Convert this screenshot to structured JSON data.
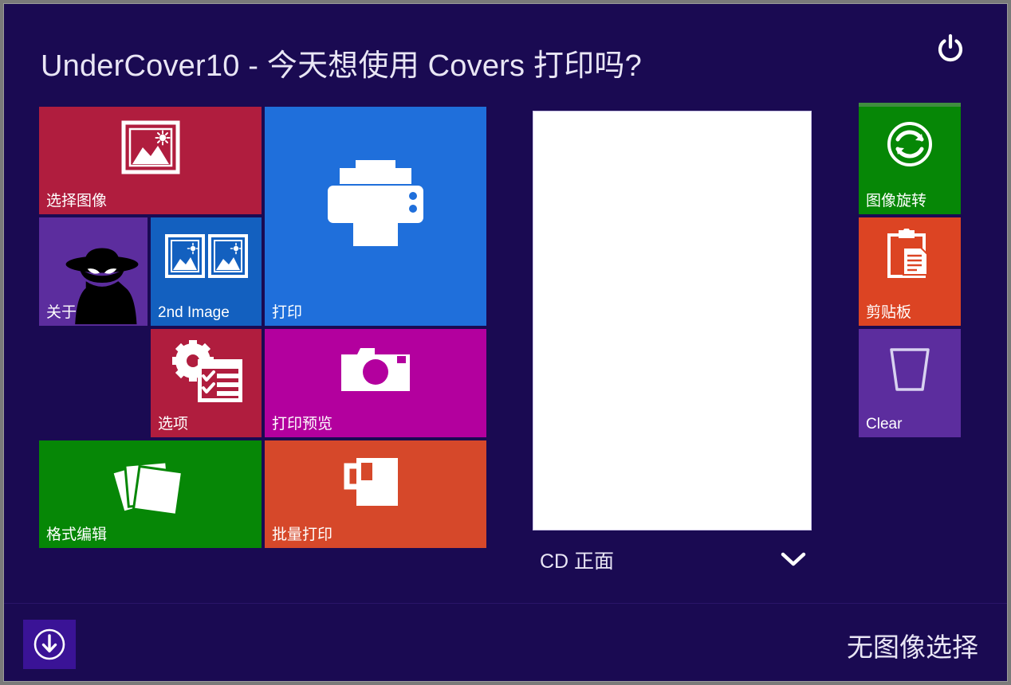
{
  "window": {
    "background_color": "#1a0a52",
    "title": "UnderCover10 - 今天想使用 Covers 打印吗?"
  },
  "header": {
    "title": "UnderCover10 - 今天想使用 Covers 打印吗?",
    "power_button_icon": "power-icon"
  },
  "tiles": {
    "main": [
      {
        "id": "select-image",
        "label": "选择图像",
        "icon": "picture-icon",
        "color": "#b01d3e"
      },
      {
        "id": "about",
        "label": "关于",
        "icon": "spy-silhouette-icon",
        "color": "#5c2d9e"
      },
      {
        "id": "2nd-image",
        "label": "2nd Image",
        "icon": "two-pictures-icon",
        "color": "#1360bf"
      },
      {
        "id": "print",
        "label": "打印",
        "icon": "printer-icon",
        "color": "#1f6fdb"
      },
      {
        "id": "options",
        "label": "选项",
        "icon": "gear-checklist-icon",
        "color": "#b01d3e"
      },
      {
        "id": "print-preview",
        "label": "打印预览",
        "icon": "camera-icon",
        "color": "#b3009e"
      },
      {
        "id": "format-edit",
        "label": "格式编辑",
        "icon": "cards-stack-icon",
        "color": "#068706"
      },
      {
        "id": "batch-print",
        "label": "批量打印",
        "icon": "mug-icon",
        "color": "#d6482a"
      }
    ],
    "sidebar": [
      {
        "id": "rotate",
        "label": "图像旋转",
        "icon": "rotate-refresh-icon",
        "color": "#068706"
      },
      {
        "id": "clipboard",
        "label": "剪贴板",
        "icon": "clipboard-icon",
        "color": "#dc4423"
      },
      {
        "id": "clear",
        "label": "Clear",
        "icon": "trash-bucket-icon",
        "color": "#5c2d9e"
      }
    ]
  },
  "preview": {
    "panel_background": "#ffffff",
    "selector_label": "CD 正面",
    "selector_icon": "chevron-down-icon"
  },
  "bottom_bar": {
    "download_button_icon": "download-circle-icon",
    "download_button_color": "#3a1396",
    "status_text": "无图像选择"
  }
}
